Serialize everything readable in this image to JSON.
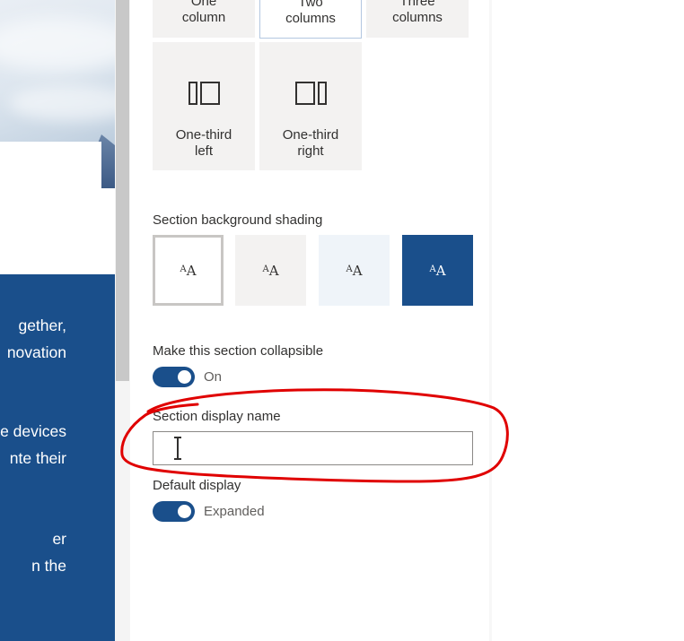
{
  "preview": {
    "paragraphs": [
      [
        "gether,",
        "novation"
      ],
      [
        "e devices",
        "nte their"
      ],
      [
        "er",
        "n the"
      ]
    ]
  },
  "layout_options": [
    {
      "label_line1": "One",
      "label_line2": "column",
      "icon": "one-column-icon",
      "selected": false
    },
    {
      "label_line1": "Two",
      "label_line2": "columns",
      "icon": "two-columns-icon",
      "selected": true
    },
    {
      "label_line1": "Three",
      "label_line2": "columns",
      "icon": "three-columns-icon",
      "selected": false
    },
    {
      "label_line1": "One-third",
      "label_line2": "left",
      "icon": "one-third-left-icon",
      "selected": false
    },
    {
      "label_line1": "One-third",
      "label_line2": "right",
      "icon": "one-third-right-icon",
      "selected": false
    }
  ],
  "shading": {
    "label": "Section background shading",
    "options": [
      {
        "text": "A",
        "sub": "A",
        "bg": "#ffffff",
        "fg": "#323130",
        "selected": true
      },
      {
        "text": "A",
        "sub": "A",
        "bg": "#f3f2f1",
        "fg": "#323130",
        "selected": false
      },
      {
        "text": "A",
        "sub": "A",
        "bg": "#eff4f9",
        "fg": "#323130",
        "selected": false
      },
      {
        "text": "A",
        "sub": "A",
        "bg": "#1a4f8b",
        "fg": "#ffffff",
        "selected": false
      }
    ]
  },
  "collapsible": {
    "label": "Make this section collapsible",
    "state": "On",
    "on": true
  },
  "display_name": {
    "label": "Section display name",
    "value": "",
    "placeholder": ""
  },
  "default_display": {
    "label": "Default display",
    "state": "Expanded",
    "on": true
  },
  "colors": {
    "accent": "#1a4f8b",
    "annotation": "#e00000"
  }
}
